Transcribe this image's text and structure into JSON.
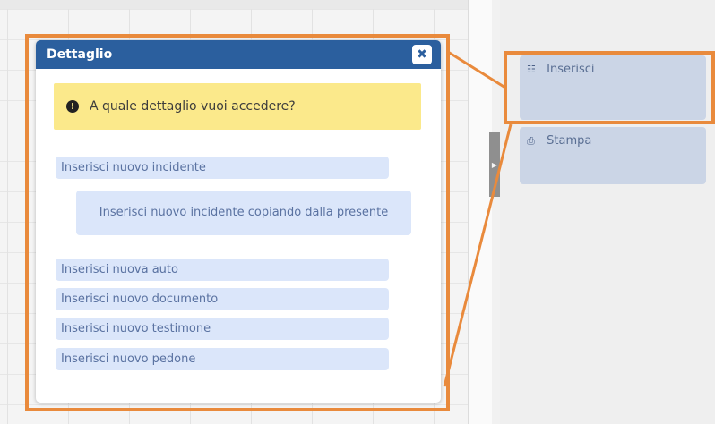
{
  "dialog": {
    "title": "Dettaglio",
    "close_icon": "close-icon",
    "alert_icon": "exclamation-circle-icon",
    "alert_text": "A quale dettaglio vuoi accedere?",
    "options": [
      "Inserisci nuovo incidente",
      "Inserisci nuovo incidente copiando dalla presente",
      "Inserisci nuova auto",
      "Inserisci nuovo documento",
      "Inserisci nuovo testimone",
      "Inserisci nuovo pedone"
    ]
  },
  "side_actions": [
    {
      "label": "Inserisci",
      "icon": "insert-card-icon"
    },
    {
      "label": "Stampa",
      "icon": "print-icon"
    }
  ],
  "colors": {
    "header": "#2b5f9e",
    "alert_bg": "#fbe98b",
    "option_bg": "#dbe6fa",
    "highlight": "#e98a3c",
    "action_bg": "#cbd5e6"
  }
}
